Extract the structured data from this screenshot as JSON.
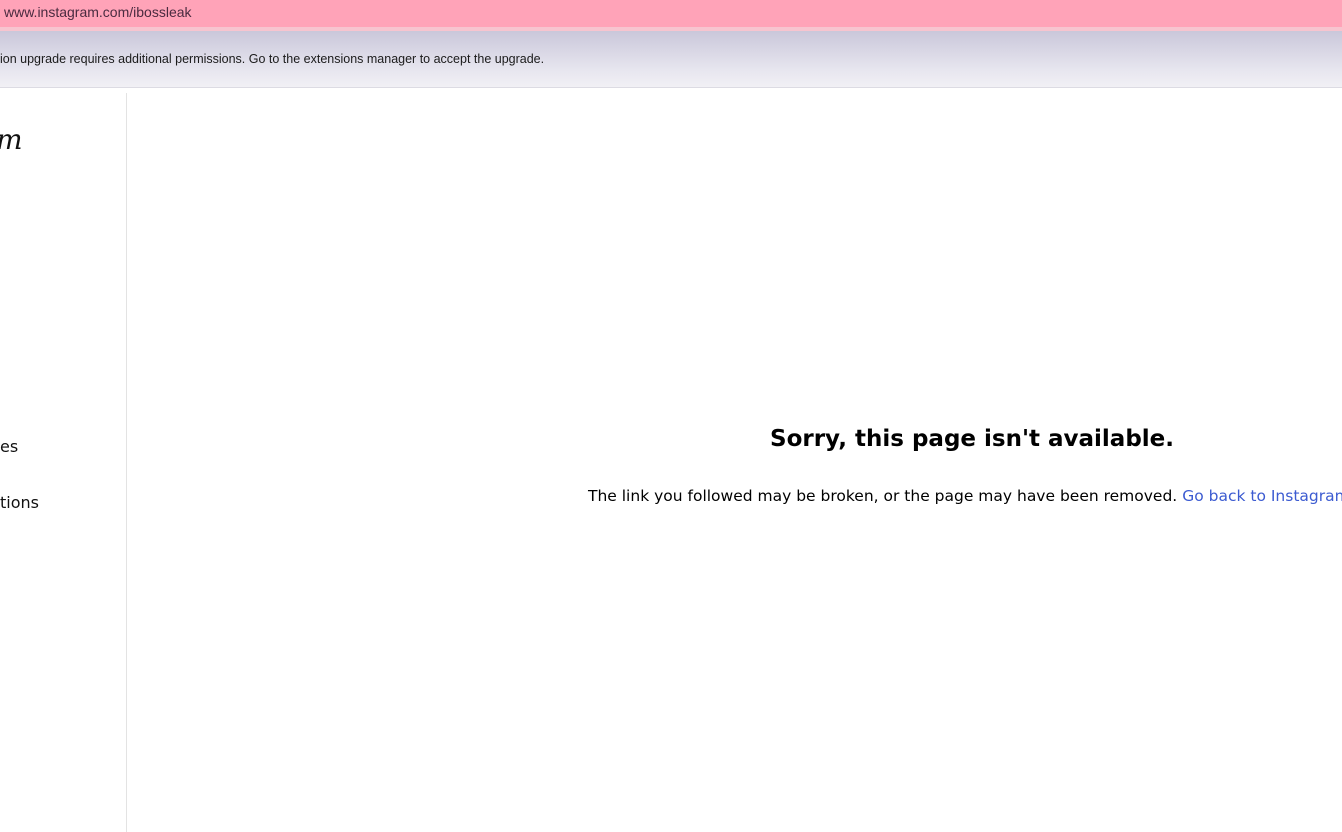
{
  "browser": {
    "url": "www.instagram.com/ibossleak"
  },
  "notification": {
    "message": "ion upgrade requires additional permissions. Go to the extensions manager to accept the upgrade."
  },
  "sidebar": {
    "logo_fragment": "m",
    "items": [
      {
        "label": "es"
      },
      {
        "label": "tions"
      }
    ]
  },
  "error": {
    "title": "Sorry, this page isn't available.",
    "body": "The link you followed may be broken, or the page may have been removed.",
    "link_text": "Go back to Instagram."
  },
  "colors": {
    "url_bar": "#ffa3b8",
    "link": "#3c5bd1"
  }
}
